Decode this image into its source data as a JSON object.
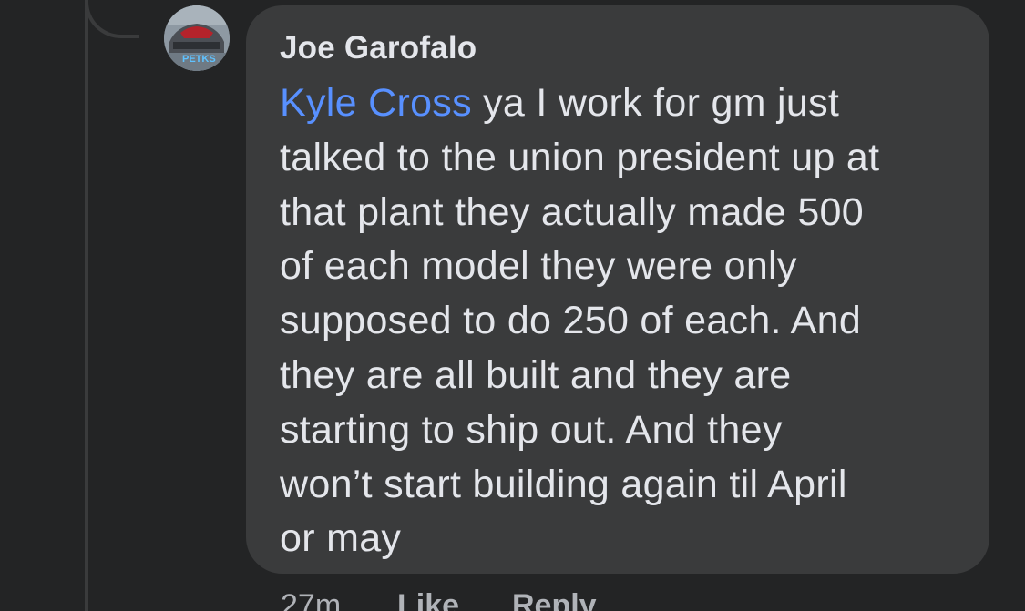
{
  "comment": {
    "author": "Joe Garofalo",
    "mention": "Kyle Cross",
    "lines": [
      " ya I work for gm just",
      "talked to the union president up at",
      "that plant they actually made 500",
      "of each model they were only",
      "supposed to do 250 of each. And",
      "they are all built and they are",
      "starting to ship out. And they",
      "won’t start building again til April",
      "or may"
    ],
    "avatar_text": "PETKS",
    "timestamp": "27m",
    "like_label": "Like",
    "reply_label": "Reply"
  },
  "colors": {
    "background": "#232425",
    "bubble": "#3a3b3c",
    "text": "#e4e6eb",
    "mention": "#5890ff",
    "meta": "#b0b3b8"
  }
}
